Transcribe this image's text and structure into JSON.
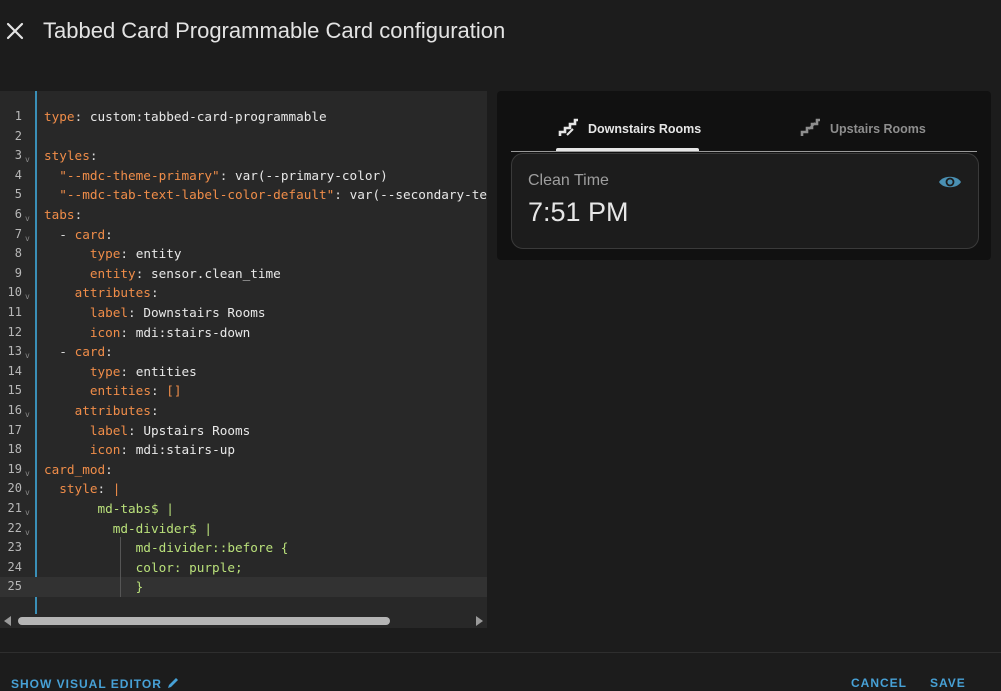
{
  "dialog": {
    "title": "Tabbed Card Programmable Card configuration",
    "close_icon": "close-icon"
  },
  "editor": {
    "lines": [
      {
        "n": "1",
        "fold": "",
        "parts": [
          [
            "k",
            "type"
          ],
          [
            "p",
            ": "
          ],
          [
            "v",
            "custom:tabbed-card-programmable"
          ]
        ]
      },
      {
        "n": "2",
        "fold": "",
        "parts": []
      },
      {
        "n": "3",
        "fold": "v",
        "parts": [
          [
            "k",
            "styles"
          ],
          [
            "p",
            ":"
          ]
        ]
      },
      {
        "n": "4",
        "fold": "",
        "parts": [
          [
            "p",
            "  "
          ],
          [
            "s",
            "\"--mdc-theme-primary\""
          ],
          [
            "p",
            ": "
          ],
          [
            "v",
            "var(--primary-color)"
          ]
        ]
      },
      {
        "n": "5",
        "fold": "",
        "parts": [
          [
            "p",
            "  "
          ],
          [
            "s",
            "\"--mdc-tab-text-label-color-default\""
          ],
          [
            "p",
            ": "
          ],
          [
            "v",
            "var(--secondary-text-color)"
          ]
        ]
      },
      {
        "n": "6",
        "fold": "v",
        "parts": [
          [
            "k",
            "tabs"
          ],
          [
            "p",
            ":"
          ]
        ]
      },
      {
        "n": "7",
        "fold": "v",
        "parts": [
          [
            "p",
            "  - "
          ],
          [
            "k",
            "card"
          ],
          [
            "p",
            ":"
          ]
        ]
      },
      {
        "n": "8",
        "fold": "",
        "parts": [
          [
            "p",
            "      "
          ],
          [
            "k",
            "type"
          ],
          [
            "p",
            ": "
          ],
          [
            "v",
            "entity"
          ]
        ]
      },
      {
        "n": "9",
        "fold": "",
        "parts": [
          [
            "p",
            "      "
          ],
          [
            "k",
            "entity"
          ],
          [
            "p",
            ": "
          ],
          [
            "v",
            "sensor.clean_time"
          ]
        ]
      },
      {
        "n": "10",
        "fold": "v",
        "parts": [
          [
            "p",
            "    "
          ],
          [
            "k",
            "attributes"
          ],
          [
            "p",
            ":"
          ]
        ]
      },
      {
        "n": "11",
        "fold": "",
        "parts": [
          [
            "p",
            "      "
          ],
          [
            "k",
            "label"
          ],
          [
            "p",
            ": "
          ],
          [
            "v",
            "Downstairs Rooms"
          ]
        ]
      },
      {
        "n": "12",
        "fold": "",
        "parts": [
          [
            "p",
            "      "
          ],
          [
            "k",
            "icon"
          ],
          [
            "p",
            ": "
          ],
          [
            "v",
            "mdi:stairs-down"
          ]
        ]
      },
      {
        "n": "13",
        "fold": "v",
        "parts": [
          [
            "p",
            "  - "
          ],
          [
            "k",
            "card"
          ],
          [
            "p",
            ":"
          ]
        ]
      },
      {
        "n": "14",
        "fold": "",
        "parts": [
          [
            "p",
            "      "
          ],
          [
            "k",
            "type"
          ],
          [
            "p",
            ": "
          ],
          [
            "v",
            "entities"
          ]
        ]
      },
      {
        "n": "15",
        "fold": "",
        "parts": [
          [
            "p",
            "      "
          ],
          [
            "k",
            "entities"
          ],
          [
            "p",
            ": "
          ],
          [
            "s",
            "[]"
          ]
        ]
      },
      {
        "n": "16",
        "fold": "v",
        "parts": [
          [
            "p",
            "    "
          ],
          [
            "k",
            "attributes"
          ],
          [
            "p",
            ":"
          ]
        ]
      },
      {
        "n": "17",
        "fold": "",
        "parts": [
          [
            "p",
            "      "
          ],
          [
            "k",
            "label"
          ],
          [
            "p",
            ": "
          ],
          [
            "v",
            "Upstairs Rooms"
          ]
        ]
      },
      {
        "n": "18",
        "fold": "",
        "parts": [
          [
            "p",
            "      "
          ],
          [
            "k",
            "icon"
          ],
          [
            "p",
            ": "
          ],
          [
            "v",
            "mdi:stairs-up"
          ]
        ]
      },
      {
        "n": "19",
        "fold": "v",
        "parts": [
          [
            "k",
            "card_mod"
          ],
          [
            "p",
            ":"
          ]
        ]
      },
      {
        "n": "20",
        "fold": "v",
        "parts": [
          [
            "p",
            "  "
          ],
          [
            "k",
            "style"
          ],
          [
            "p",
            ": "
          ],
          [
            "s",
            "|"
          ]
        ]
      },
      {
        "n": "21",
        "fold": "v",
        "parts": [
          [
            "p",
            "       "
          ],
          [
            "g",
            "md-tabs$ |"
          ]
        ]
      },
      {
        "n": "22",
        "fold": "v",
        "parts": [
          [
            "p",
            "         "
          ],
          [
            "g",
            "md-divider$ |"
          ]
        ]
      },
      {
        "n": "23",
        "fold": "",
        "parts": [
          [
            "p",
            "            "
          ],
          [
            "g",
            "md-divider::before {"
          ]
        ]
      },
      {
        "n": "24",
        "fold": "",
        "parts": [
          [
            "p",
            "            "
          ],
          [
            "g",
            "color: purple;"
          ]
        ]
      },
      {
        "n": "25",
        "fold": "",
        "parts": [
          [
            "p",
            "            "
          ],
          [
            "g",
            "}"
          ]
        ]
      }
    ],
    "active_line": 25
  },
  "preview": {
    "tabs": [
      {
        "label": "Downstairs Rooms",
        "icon": "stairs-down-icon",
        "active": true
      },
      {
        "label": "Upstairs Rooms",
        "icon": "stairs-up-icon",
        "active": false
      }
    ],
    "entity": {
      "name": "Clean Time",
      "state": "7:51 PM",
      "icon": "eye-icon"
    }
  },
  "footer": {
    "show_visual_editor": "SHOW VISUAL EDITOR",
    "cancel": "CANCEL",
    "save": "SAVE"
  },
  "colors": {
    "accent": "#47a1d6",
    "yaml_key": "#f08d49",
    "yaml_block": "#b9e07a"
  }
}
